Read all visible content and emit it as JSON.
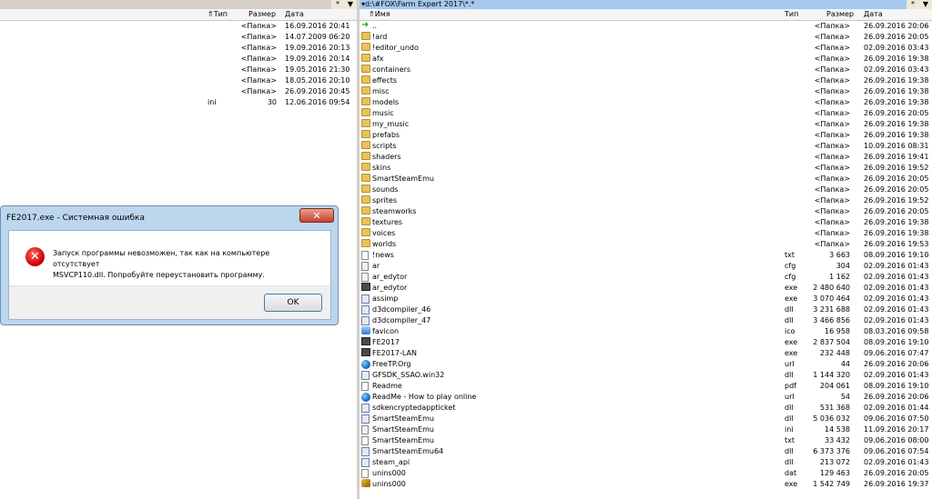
{
  "left": {
    "path": "",
    "star": "*",
    "drop": "▼",
    "headers": {
      "type": "⇑Тип",
      "size": "Размер",
      "date": "Дата"
    },
    "rows": [
      {
        "name": "",
        "type": "",
        "size": "<Папка>",
        "date": "16.09.2016 20:41"
      },
      {
        "name": "",
        "type": "",
        "size": "<Папка>",
        "date": "14.07.2009 06:20"
      },
      {
        "name": "",
        "type": "",
        "size": "<Папка>",
        "date": "19.09.2016 20:13"
      },
      {
        "name": "",
        "type": "",
        "size": "<Папка>",
        "date": "19.09.2016 20:14"
      },
      {
        "name": "",
        "type": "",
        "size": "<Папка>",
        "date": "19.05.2016 21:30"
      },
      {
        "name": "",
        "type": "",
        "size": "<Папка>",
        "date": "18.05.2016 20:10"
      },
      {
        "name": "",
        "type": "",
        "size": "<Папка>",
        "date": "26.09.2016 20:45"
      },
      {
        "name": "",
        "type": "ini",
        "size": "30",
        "date": "12.06.2016 09:54"
      }
    ]
  },
  "right": {
    "path": "▾d:\\#FOX\\Farm Expert 2017\\*.*",
    "star": "*",
    "drop": "▼",
    "headers": {
      "name": "⇑Имя",
      "type": "Тип",
      "size": "Размер",
      "date": "Дата"
    },
    "rows": [
      {
        "icon": "up",
        "name": "..",
        "type": "",
        "size": "<Папка>",
        "date": "26.09.2016 20:06"
      },
      {
        "icon": "folder",
        "name": "!ard",
        "type": "",
        "size": "<Папка>",
        "date": "26.09.2016 20:05"
      },
      {
        "icon": "folder",
        "name": "!editor_undo",
        "type": "",
        "size": "<Папка>",
        "date": "02.09.2016 03:43"
      },
      {
        "icon": "folder",
        "name": "afx",
        "type": "",
        "size": "<Папка>",
        "date": "26.09.2016 19:38"
      },
      {
        "icon": "folder",
        "name": "containers",
        "type": "",
        "size": "<Папка>",
        "date": "02.09.2016 03:43"
      },
      {
        "icon": "folder",
        "name": "effects",
        "type": "",
        "size": "<Папка>",
        "date": "26.09.2016 19:38"
      },
      {
        "icon": "folder",
        "name": "misc",
        "type": "",
        "size": "<Папка>",
        "date": "26.09.2016 19:38"
      },
      {
        "icon": "folder",
        "name": "models",
        "type": "",
        "size": "<Папка>",
        "date": "26.09.2016 19:38"
      },
      {
        "icon": "folder",
        "name": "music",
        "type": "",
        "size": "<Папка>",
        "date": "26.09.2016 20:05"
      },
      {
        "icon": "folder",
        "name": "my_music",
        "type": "",
        "size": "<Папка>",
        "date": "26.09.2016 19:38"
      },
      {
        "icon": "folder",
        "name": "prefabs",
        "type": "",
        "size": "<Папка>",
        "date": "26.09.2016 19:38"
      },
      {
        "icon": "folder",
        "name": "scripts",
        "type": "",
        "size": "<Папка>",
        "date": "10.09.2016 08:31"
      },
      {
        "icon": "folder",
        "name": "shaders",
        "type": "",
        "size": "<Папка>",
        "date": "26.09.2016 19:41"
      },
      {
        "icon": "folder",
        "name": "skins",
        "type": "",
        "size": "<Папка>",
        "date": "26.09.2016 19:52"
      },
      {
        "icon": "folder",
        "name": "SmartSteamEmu",
        "type": "",
        "size": "<Папка>",
        "date": "26.09.2016 20:05"
      },
      {
        "icon": "folder",
        "name": "sounds",
        "type": "",
        "size": "<Папка>",
        "date": "26.09.2016 20:05"
      },
      {
        "icon": "folder",
        "name": "sprites",
        "type": "",
        "size": "<Папка>",
        "date": "26.09.2016 19:52"
      },
      {
        "icon": "folder",
        "name": "steamworks",
        "type": "",
        "size": "<Папка>",
        "date": "26.09.2016 20:05"
      },
      {
        "icon": "folder",
        "name": "textures",
        "type": "",
        "size": "<Папка>",
        "date": "26.09.2016 19:38"
      },
      {
        "icon": "folder",
        "name": "voices",
        "type": "",
        "size": "<Папка>",
        "date": "26.09.2016 19:38"
      },
      {
        "icon": "folder",
        "name": "worlds",
        "type": "",
        "size": "<Папка>",
        "date": "26.09.2016 19:53"
      },
      {
        "icon": "file",
        "name": "!news",
        "type": "txt",
        "size": "3 663",
        "date": "08.09.2016 19:10"
      },
      {
        "icon": "cfgf",
        "name": "ar",
        "type": "cfg",
        "size": "304",
        "date": "02.09.2016 01:43"
      },
      {
        "icon": "cfgf",
        "name": "ar_edytor",
        "type": "cfg",
        "size": "1 162",
        "date": "02.09.2016 01:43"
      },
      {
        "icon": "exe",
        "name": "ar_edytor",
        "type": "exe",
        "size": "2 480 640",
        "date": "02.09.2016 01:43"
      },
      {
        "icon": "dll",
        "name": "assimp",
        "type": "exe",
        "size": "3 070 464",
        "date": "02.09.2016 01:43"
      },
      {
        "icon": "dll",
        "name": "d3dcompiler_46",
        "type": "dll",
        "size": "3 231 688",
        "date": "02.09.2016 01:43"
      },
      {
        "icon": "dll",
        "name": "d3dcompiler_47",
        "type": "dll",
        "size": "3 466 856",
        "date": "02.09.2016 01:43"
      },
      {
        "icon": "favicon",
        "name": "favicon",
        "type": "ico",
        "size": "16 958",
        "date": "08.03.2016 09:58"
      },
      {
        "icon": "exe",
        "name": "FE2017",
        "type": "exe",
        "size": "2 837 504",
        "date": "08.09.2016 19:10"
      },
      {
        "icon": "exe",
        "name": "FE2017-LAN",
        "type": "exe",
        "size": "232 448",
        "date": "09.06.2016 07:47"
      },
      {
        "icon": "globe",
        "name": "FreeTP.Org",
        "type": "url",
        "size": "44",
        "date": "26.09.2016 20:06"
      },
      {
        "icon": "dll",
        "name": "GFSDK_SSAO.win32",
        "type": "dll",
        "size": "1 144 320",
        "date": "02.09.2016 01:43"
      },
      {
        "icon": "file",
        "name": "Readme",
        "type": "pdf",
        "size": "204 061",
        "date": "08.09.2016 19:10"
      },
      {
        "icon": "globe",
        "name": "ReadMe - How to play online",
        "type": "url",
        "size": "54",
        "date": "26.09.2016 20:06"
      },
      {
        "icon": "dll",
        "name": "sdkencryptedappticket",
        "type": "dll",
        "size": "531 368",
        "date": "02.09.2016 01:44"
      },
      {
        "icon": "dll",
        "name": "SmartSteamEmu",
        "type": "dll",
        "size": "5 036 032",
        "date": "09.06.2016 07:50"
      },
      {
        "icon": "cfgf",
        "name": "SmartSteamEmu",
        "type": "ini",
        "size": "14 538",
        "date": "11.09.2016 20:17"
      },
      {
        "icon": "file",
        "name": "SmartSteamEmu",
        "type": "txt",
        "size": "33 432",
        "date": "09.06.2016 08:00"
      },
      {
        "icon": "dll",
        "name": "SmartSteamEmu64",
        "type": "dll",
        "size": "6 373 376",
        "date": "09.06.2016 07:54"
      },
      {
        "icon": "dll",
        "name": "steam_api",
        "type": "dll",
        "size": "213 072",
        "date": "02.09.2016 01:43"
      },
      {
        "icon": "file",
        "name": "unins000",
        "type": "dat",
        "size": "129 463",
        "date": "26.09.2016 20:05"
      },
      {
        "icon": "installer",
        "name": "unins000",
        "type": "exe",
        "size": "1 542 749",
        "date": "26.09.2016 19:37"
      }
    ]
  },
  "dialog": {
    "title": "FE2017.exe - Системная ошибка",
    "close": "✕",
    "error_glyph": "✕",
    "message_line1": "Запуск программы невозможен, так как на компьютере отсутствует",
    "message_line2": "MSVCP110.dll. Попробуйте переустановить программу.",
    "ok_label": "OK"
  }
}
